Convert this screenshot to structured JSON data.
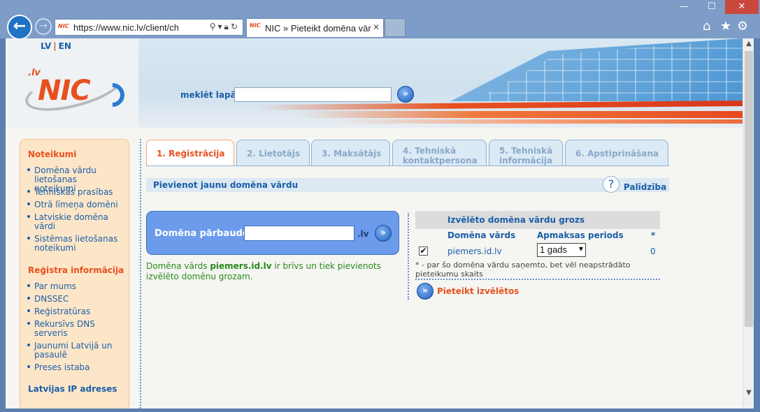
{
  "browser": {
    "address_url": "https://www.nic.lv/client/check_",
    "tab_title": "NIC » Pieteikt domēna vārd...",
    "favicon_text": "NIC",
    "win_min": "—",
    "win_max": "☐",
    "win_close": "✕"
  },
  "header": {
    "lang_lv": "LV",
    "lang_sep": "|",
    "lang_en": "EN",
    "logo_prefix": ".lv",
    "logo_text": "NIC",
    "search_label": "meklēt lapā",
    "search_value": ""
  },
  "sidebar": {
    "section1_title": "Noteikumi",
    "section1_items": [
      "Domēna vārdu lietošanas noteikumi",
      "Tehniskās prasības",
      "Otrā līmeņa domēni",
      "Latviskie domēna vārdi",
      "Sistēmas lietošanas noteikumi"
    ],
    "section2_title": "Reģistra informācija",
    "section2_items": [
      "Par mums",
      "DNSSEC",
      "Reģistratūras",
      "Rekursīvs DNS serveris",
      "Jaunumi Latvijā un pasaulē",
      "Preses istaba"
    ],
    "section3_title": "Latvijas IP adreses"
  },
  "tabs": [
    "1. Reģistrācija",
    "2. Lietotājs",
    "3. Maksātājs",
    "4. Tehniskā kontaktpersona",
    "5. Tehniskā informācija",
    "6. Apstiprināšana"
  ],
  "section": {
    "title": "Pievienot jaunu domēna vārdu",
    "help_label": "Palīdzība",
    "help_icon": "?"
  },
  "domain_check": {
    "label": "Domēna pārbaude",
    "input_value": "",
    "suffix": ".lv",
    "result_prefix": "Domēna vārds",
    "result_domain": "piemers.id.lv",
    "result_suffix": "ir brīvs un tiek pievienots izvēlēto domēnu grozam."
  },
  "cart": {
    "title": "Izvēlēto domēna vārdu grozs",
    "col_domain": "Domēna vārds",
    "col_period": "Apmaksas periods",
    "col_star": "*",
    "rows": [
      {
        "checked": "✔",
        "domain": "piemers.id.lv",
        "period": "1 gads",
        "count": "0"
      }
    ],
    "note": "* - par šo domēna vārdu saņemto, bet vēl neapstrādāto pieteikumu skaits",
    "submit_label": "Pieteikt izvēlētos"
  },
  "colors": {
    "accent_orange": "#e8501e",
    "link_blue": "#1a5fa8",
    "success_green": "#2a8a1a"
  }
}
